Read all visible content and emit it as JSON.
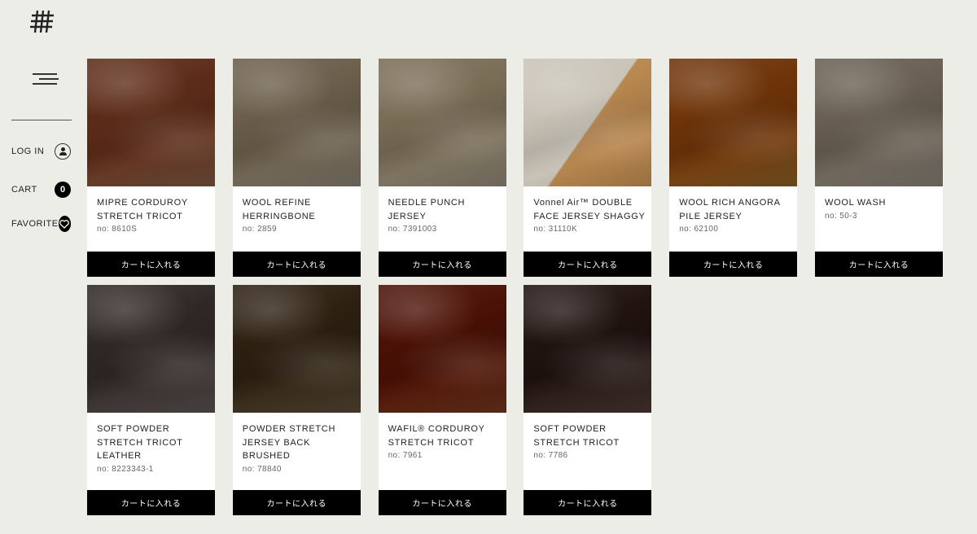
{
  "sidebar": {
    "login_label": "LOG IN",
    "cart_label": "CART",
    "cart_count": "0",
    "favorite_label": "FAVORITE"
  },
  "products": [
    {
      "name": "MIPRE CORDUROY STRETCH TRICOT",
      "no": "no: 8610S",
      "cart": "カートに入れる",
      "color": "#9a6a4f"
    },
    {
      "name": "WOOL REFINE HERRINGBONE",
      "no": "no: 2859",
      "cart": "カートに入れる",
      "color": "#a59b8a"
    },
    {
      "name": "NEEDLE PUNCH JERSEY",
      "no": "no: 7391003",
      "cart": "カートに入れる",
      "color": "#b0a794"
    },
    {
      "name": "Vonnel Air™ DOUBLE FACE JERSEY SHAGGY",
      "no": "no: 31110K",
      "cart": "カートに入れる",
      "color": "#c9c3b7",
      "accent": "#b8874f"
    },
    {
      "name": "WOOL RICH ANGORA PILE JERSEY",
      "no": "no: 62100",
      "cart": "カートに入れる",
      "color": "#a8732f"
    },
    {
      "name": "WOOL WASH",
      "no": "no: 50-3",
      "cart": "カートに入れる",
      "color": "#a49c91"
    },
    {
      "name": "SOFT POWDER STRETCH TRICOT LEATHER",
      "no": "no: 8223343-1",
      "cart": "カートに入れる",
      "color": "#6f6564"
    },
    {
      "name": "POWDER STRETCH JERSEY BACK BRUSHED",
      "no": "no: 78840",
      "cart": "カートに入れる",
      "color": "#6b5a42"
    },
    {
      "name": "WAFIL® CORDUROY STRETCH TRICOT",
      "no": "no: 7961",
      "cart": "カートに入れる",
      "color": "#8a4223"
    },
    {
      "name": "SOFT POWDER STRETCH TRICOT",
      "no": "no: 7786",
      "cart": "カートに入れる",
      "color": "#5a4540"
    }
  ]
}
